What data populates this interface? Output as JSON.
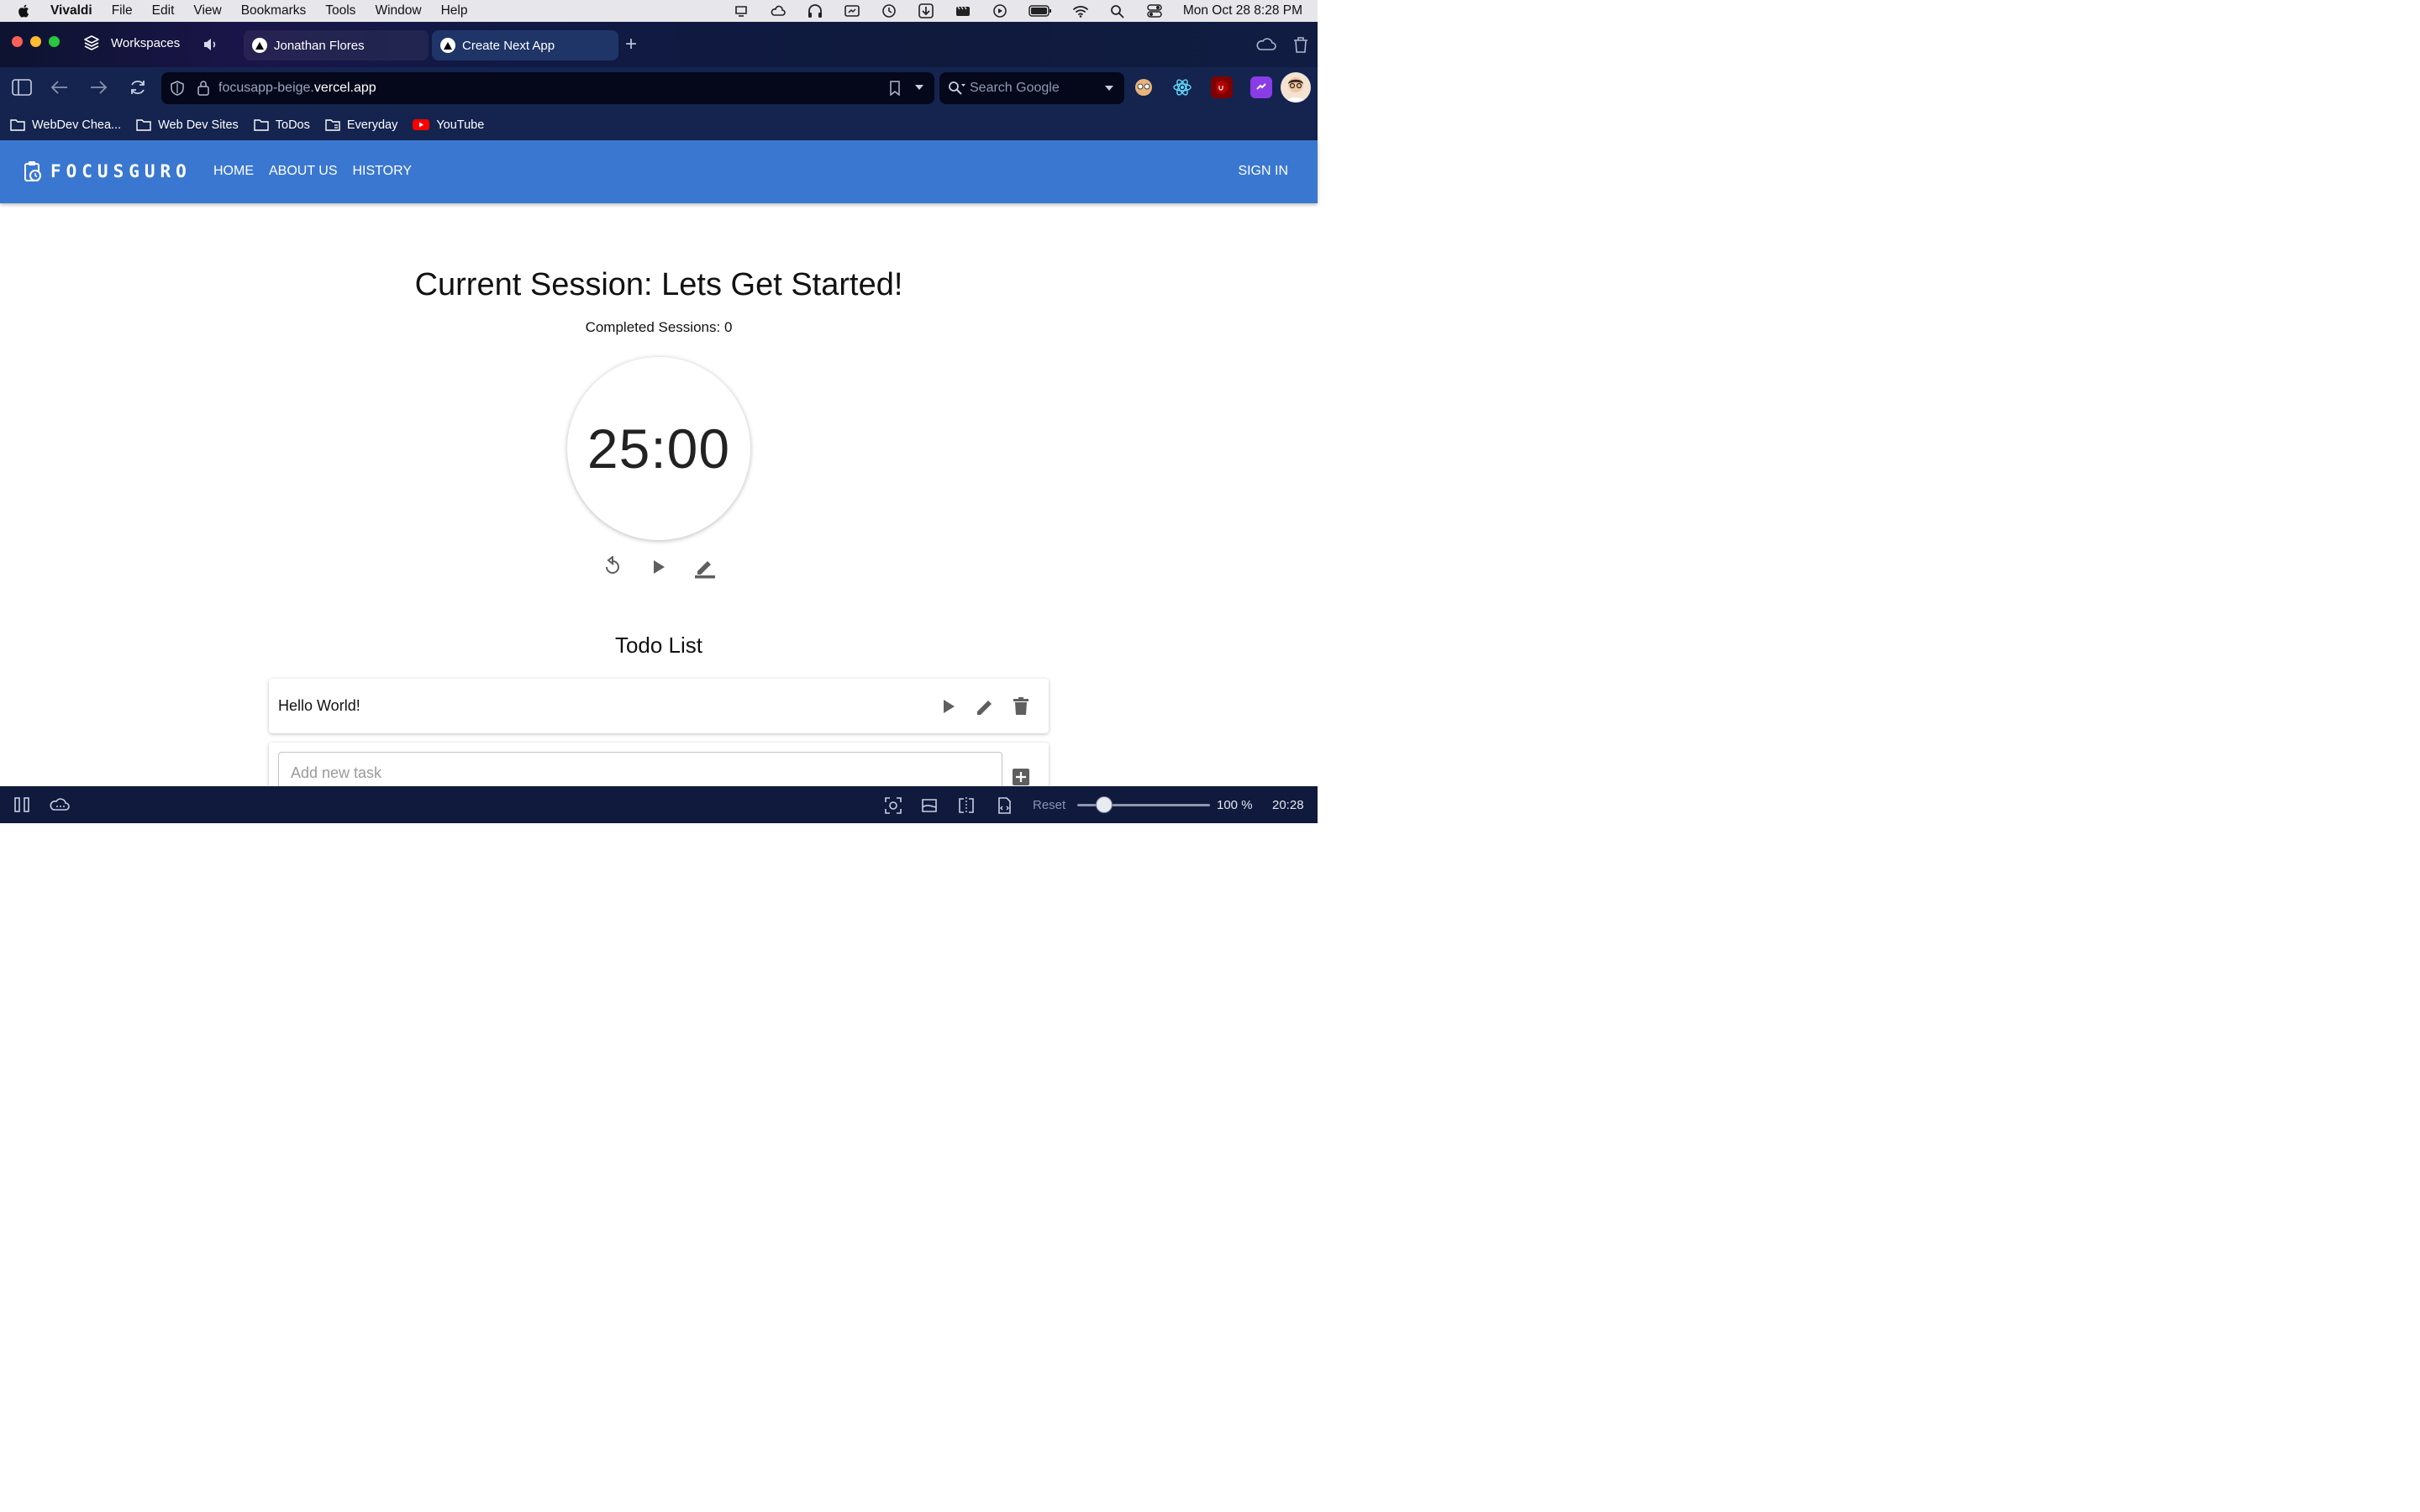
{
  "os_menubar": {
    "app_name": "Vivaldi",
    "menus": [
      "File",
      "Edit",
      "View",
      "Bookmarks",
      "Tools",
      "Window",
      "Help"
    ],
    "clock": "Mon Oct 28  8:28 PM"
  },
  "browser": {
    "workspaces_label": "Workspaces",
    "tabs": [
      {
        "title": "Jonathan Flores",
        "active": false
      },
      {
        "title": "Create Next App",
        "active": true
      }
    ],
    "url": {
      "subdomain": "focusapp-beige.",
      "domain": "vercel.app"
    },
    "search_placeholder": "Search Google",
    "bookmarks": [
      "WebDev Chea...",
      "Web Dev Sites",
      "ToDos",
      "Everyday",
      "YouTube"
    ],
    "accent_color": "#14244f"
  },
  "app": {
    "brand": "FOCUSGURO",
    "nav": {
      "home": "HOME",
      "about": "ABOUT US",
      "history": "HISTORY",
      "signin": "SIGN IN"
    },
    "brand_color": "#3a77d0"
  },
  "session": {
    "title": "Current Session: Lets Get Started!",
    "completed": "Completed Sessions: 0",
    "timer": "25:00",
    "controls": [
      "reset-icon",
      "play-icon",
      "edit-icon"
    ]
  },
  "todo": {
    "title": "Todo List",
    "items": [
      {
        "text": "Hello World!"
      }
    ],
    "add_placeholder": "Add new task"
  },
  "statusbar": {
    "reset_label": "Reset",
    "zoom": "100 %",
    "zoom_level": 0.2,
    "time": "20:28"
  }
}
